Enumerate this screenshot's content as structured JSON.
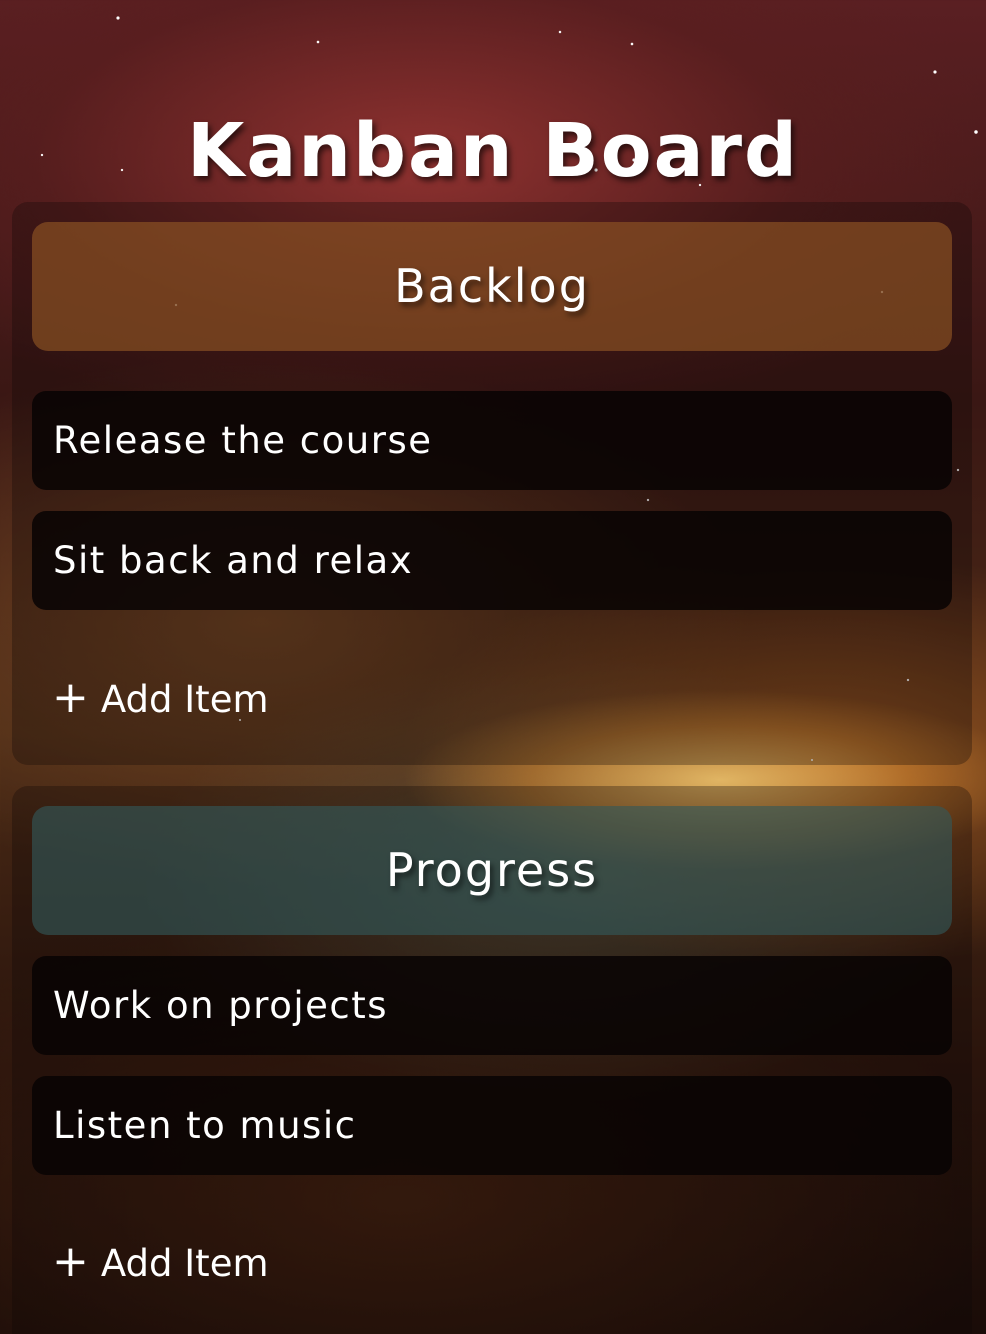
{
  "board": {
    "title": "Kanban Board"
  },
  "columns": [
    {
      "title": "Backlog",
      "items": [
        "Release the course",
        "Sit back and relax"
      ],
      "add_label": "Add Item"
    },
    {
      "title": "Progress",
      "items": [
        "Work on projects",
        "Listen to music"
      ],
      "add_label": "Add Item"
    }
  ],
  "icons": {
    "add": "plus-icon"
  },
  "colors": {
    "backlog_header": "#8c5224",
    "progress_header": "#32585a",
    "item_background": "#080404",
    "text": "#ffffff"
  }
}
